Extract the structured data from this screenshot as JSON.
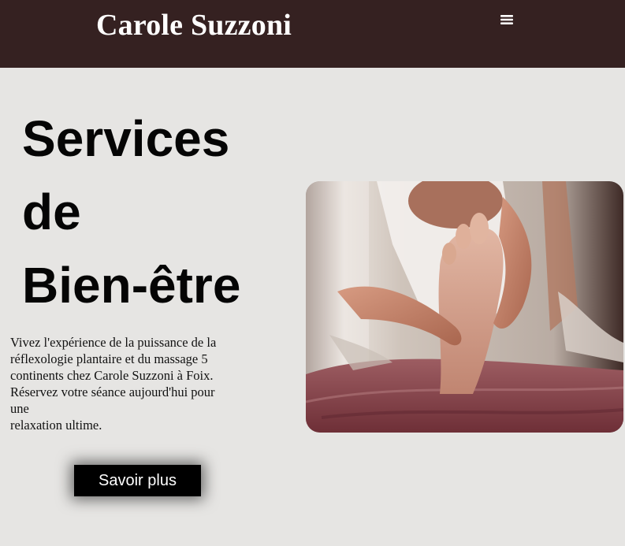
{
  "header": {
    "brand": "Carole Suzzoni",
    "menu_icon": "hamburger-menu-icon",
    "background": "#352121"
  },
  "hero": {
    "title_lines": [
      "Services",
      "de",
      "Bien-être"
    ],
    "description_lines": [
      "Vivez l'expérience de la puissance de la",
      "réflexologie plantaire et du massage 5",
      "continents chez Carole Suzzoni à Foix.",
      "Réservez votre séance aujourd'hui pour",
      "une",
      "relaxation ultime."
    ],
    "cta_label": "Savoir plus"
  },
  "colors": {
    "page_background": "#e6e5e3",
    "button_background": "#000000"
  }
}
